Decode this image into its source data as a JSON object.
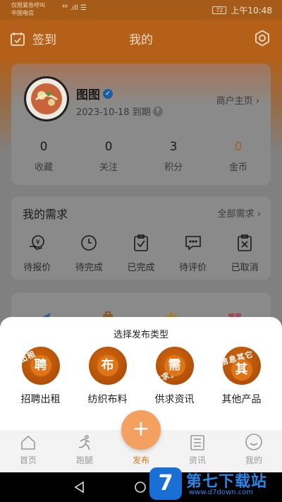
{
  "status_bar": {
    "carrier_line1": "仅限紧急呼叫",
    "carrier_line2": "中国电信",
    "signal": "⁴⁶ .ıll ☰",
    "battery": "72",
    "time": "上午10:48"
  },
  "header": {
    "signin_label": "签到",
    "title": "我的"
  },
  "profile": {
    "username": "图图",
    "verified_icon": "verified-badge-icon",
    "expiry": "2023-10-18 到期",
    "merchant_link": "商户主页 ›",
    "stats": [
      {
        "value": "0",
        "label": "收藏"
      },
      {
        "value": "0",
        "label": "关注"
      },
      {
        "value": "3",
        "label": "积分"
      },
      {
        "value": "0",
        "label": "金币"
      }
    ]
  },
  "needs": {
    "title": "我的需求",
    "all_link": "全部需求 ›",
    "items": [
      {
        "label": "待报价",
        "icon": "quote-yen-icon"
      },
      {
        "label": "待完成",
        "icon": "clock-icon"
      },
      {
        "label": "已完成",
        "icon": "clipboard-check-icon"
      },
      {
        "label": "待评价",
        "icon": "comment-icon"
      },
      {
        "label": "已取消",
        "icon": "clipboard-x-icon"
      }
    ]
  },
  "publish_sheet": {
    "title": "选择发布类型",
    "options": [
      {
        "label": "招聘出租",
        "glyph": "聘",
        "band": "出租"
      },
      {
        "label": "纺织布料",
        "glyph": "布",
        "band": ""
      },
      {
        "label": "供求资讯",
        "glyph": "需",
        "band": "供求资"
      },
      {
        "label": "其他产品",
        "glyph": "其",
        "band": "信息其它"
      }
    ]
  },
  "tabbar": {
    "tabs": [
      {
        "label": "首页",
        "icon": "home-icon"
      },
      {
        "label": "跑腿",
        "icon": "runner-icon"
      },
      {
        "label": "发布",
        "icon": "plus-icon"
      },
      {
        "label": "资讯",
        "icon": "news-icon"
      },
      {
        "label": "我的",
        "icon": "smile-icon"
      }
    ],
    "fab_symbol": "+"
  },
  "watermark": {
    "logo_char": "7",
    "name": "第七下载站",
    "url": "www.d7down.com"
  },
  "colors": {
    "accent": "#e07418",
    "header": "#b46018"
  }
}
